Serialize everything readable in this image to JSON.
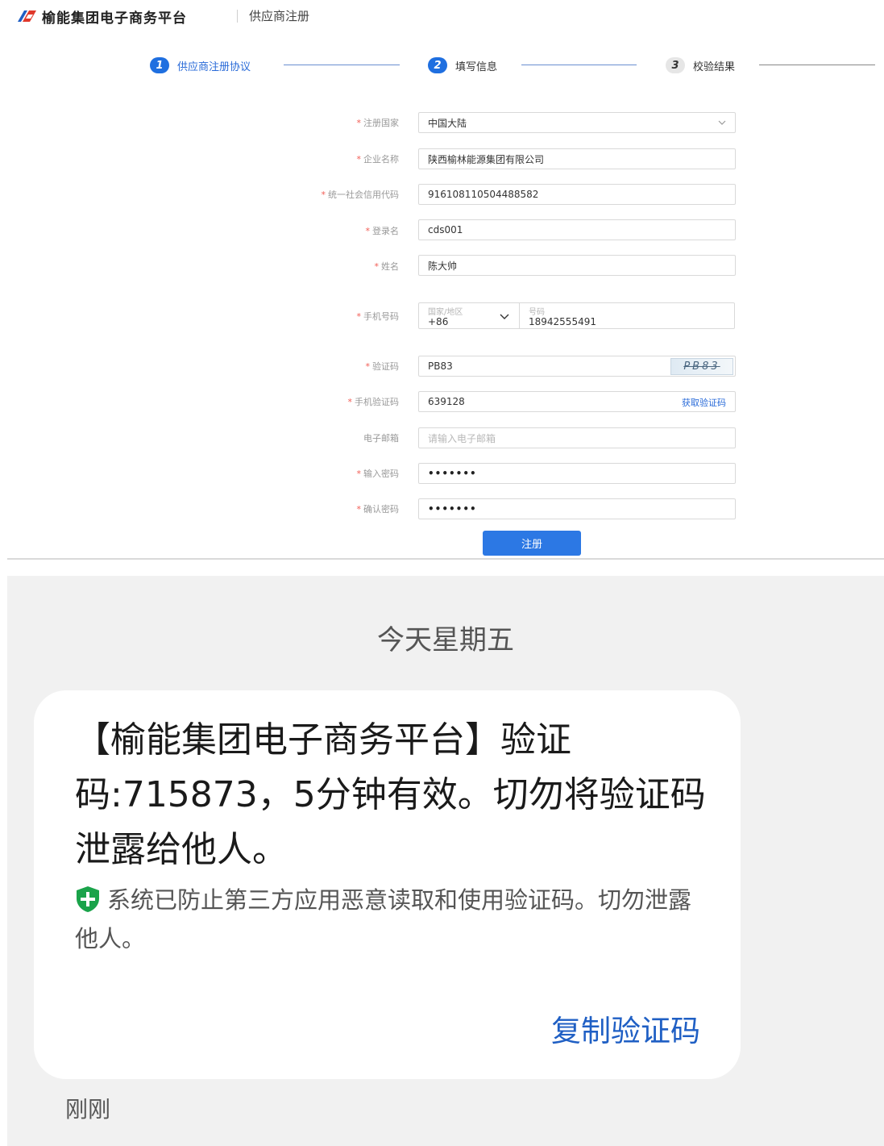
{
  "header": {
    "brand": "榆能集团电子商务平台",
    "page_name": "供应商注册"
  },
  "steps": [
    {
      "num": "1",
      "label": "供应商注册协议",
      "state": "active"
    },
    {
      "num": "2",
      "label": "填写信息",
      "state": "active"
    },
    {
      "num": "3",
      "label": "校验结果",
      "state": "pending"
    }
  ],
  "form": {
    "country": {
      "label": "注册国家",
      "value": "中国大陆"
    },
    "company": {
      "label": "企业名称",
      "value": "陕西榆林能源集团有限公司"
    },
    "credit_code": {
      "label": "统一社会信用代码",
      "value": "916108110504488582"
    },
    "login_name": {
      "label": "登录名",
      "value": "cds001"
    },
    "name": {
      "label": "姓名",
      "value": "陈大帅"
    },
    "phone": {
      "label": "手机号码",
      "country_caption": "国家/地区",
      "country_value": "+86",
      "number_caption": "号码",
      "number_value": "18942555491"
    },
    "captcha": {
      "label": "验证码",
      "value": "PB83",
      "image_text": "PB83"
    },
    "sms_code": {
      "label": "手机验证码",
      "value": "639128",
      "get_code": "获取验证码"
    },
    "email": {
      "label": "电子邮箱",
      "placeholder": "请输入电子邮箱"
    },
    "password": {
      "label": "输入密码",
      "value": "•••••••"
    },
    "confirm_password": {
      "label": "确认密码",
      "value": "•••••••"
    },
    "required_mark": "*",
    "submit": "注册"
  },
  "sms": {
    "day": "今天星期五",
    "body": "【榆能集团电子商务平台】验证码:715873，5分钟有效。切勿将验证码泄露给他人。",
    "notice": "系统已防止第三方应用恶意读取和使用验证码。切勿泄露他人。",
    "copy_button": "复制验证码",
    "time": "刚刚"
  },
  "colors": {
    "primary": "#2c78e4",
    "step_active": "#1f6fe0",
    "required": "#f25c54",
    "shield_green": "#1aa34a",
    "copy_blue": "#1f5fc4"
  },
  "icons": {
    "logo": "brand-logo-icon",
    "dropdown": "chevron-down-icon",
    "shield": "shield-check-icon"
  }
}
